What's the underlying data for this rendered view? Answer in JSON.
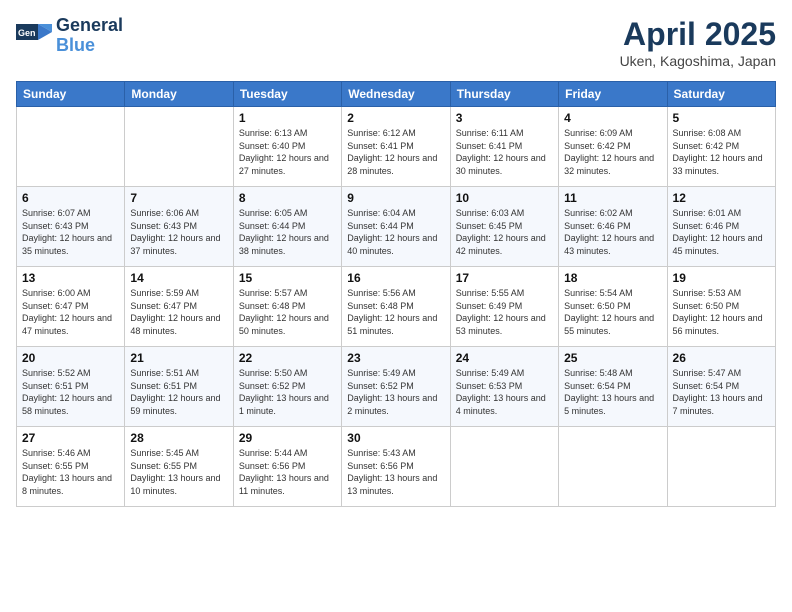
{
  "header": {
    "logo_line1": "General",
    "logo_line2": "Blue",
    "month": "April 2025",
    "location": "Uken, Kagoshima, Japan"
  },
  "weekdays": [
    "Sunday",
    "Monday",
    "Tuesday",
    "Wednesday",
    "Thursday",
    "Friday",
    "Saturday"
  ],
  "weeks": [
    [
      {
        "day": null
      },
      {
        "day": null
      },
      {
        "day": "1",
        "sunrise": "Sunrise: 6:13 AM",
        "sunset": "Sunset: 6:40 PM",
        "daylight": "Daylight: 12 hours and 27 minutes."
      },
      {
        "day": "2",
        "sunrise": "Sunrise: 6:12 AM",
        "sunset": "Sunset: 6:41 PM",
        "daylight": "Daylight: 12 hours and 28 minutes."
      },
      {
        "day": "3",
        "sunrise": "Sunrise: 6:11 AM",
        "sunset": "Sunset: 6:41 PM",
        "daylight": "Daylight: 12 hours and 30 minutes."
      },
      {
        "day": "4",
        "sunrise": "Sunrise: 6:09 AM",
        "sunset": "Sunset: 6:42 PM",
        "daylight": "Daylight: 12 hours and 32 minutes."
      },
      {
        "day": "5",
        "sunrise": "Sunrise: 6:08 AM",
        "sunset": "Sunset: 6:42 PM",
        "daylight": "Daylight: 12 hours and 33 minutes."
      }
    ],
    [
      {
        "day": "6",
        "sunrise": "Sunrise: 6:07 AM",
        "sunset": "Sunset: 6:43 PM",
        "daylight": "Daylight: 12 hours and 35 minutes."
      },
      {
        "day": "7",
        "sunrise": "Sunrise: 6:06 AM",
        "sunset": "Sunset: 6:43 PM",
        "daylight": "Daylight: 12 hours and 37 minutes."
      },
      {
        "day": "8",
        "sunrise": "Sunrise: 6:05 AM",
        "sunset": "Sunset: 6:44 PM",
        "daylight": "Daylight: 12 hours and 38 minutes."
      },
      {
        "day": "9",
        "sunrise": "Sunrise: 6:04 AM",
        "sunset": "Sunset: 6:44 PM",
        "daylight": "Daylight: 12 hours and 40 minutes."
      },
      {
        "day": "10",
        "sunrise": "Sunrise: 6:03 AM",
        "sunset": "Sunset: 6:45 PM",
        "daylight": "Daylight: 12 hours and 42 minutes."
      },
      {
        "day": "11",
        "sunrise": "Sunrise: 6:02 AM",
        "sunset": "Sunset: 6:46 PM",
        "daylight": "Daylight: 12 hours and 43 minutes."
      },
      {
        "day": "12",
        "sunrise": "Sunrise: 6:01 AM",
        "sunset": "Sunset: 6:46 PM",
        "daylight": "Daylight: 12 hours and 45 minutes."
      }
    ],
    [
      {
        "day": "13",
        "sunrise": "Sunrise: 6:00 AM",
        "sunset": "Sunset: 6:47 PM",
        "daylight": "Daylight: 12 hours and 47 minutes."
      },
      {
        "day": "14",
        "sunrise": "Sunrise: 5:59 AM",
        "sunset": "Sunset: 6:47 PM",
        "daylight": "Daylight: 12 hours and 48 minutes."
      },
      {
        "day": "15",
        "sunrise": "Sunrise: 5:57 AM",
        "sunset": "Sunset: 6:48 PM",
        "daylight": "Daylight: 12 hours and 50 minutes."
      },
      {
        "day": "16",
        "sunrise": "Sunrise: 5:56 AM",
        "sunset": "Sunset: 6:48 PM",
        "daylight": "Daylight: 12 hours and 51 minutes."
      },
      {
        "day": "17",
        "sunrise": "Sunrise: 5:55 AM",
        "sunset": "Sunset: 6:49 PM",
        "daylight": "Daylight: 12 hours and 53 minutes."
      },
      {
        "day": "18",
        "sunrise": "Sunrise: 5:54 AM",
        "sunset": "Sunset: 6:50 PM",
        "daylight": "Daylight: 12 hours and 55 minutes."
      },
      {
        "day": "19",
        "sunrise": "Sunrise: 5:53 AM",
        "sunset": "Sunset: 6:50 PM",
        "daylight": "Daylight: 12 hours and 56 minutes."
      }
    ],
    [
      {
        "day": "20",
        "sunrise": "Sunrise: 5:52 AM",
        "sunset": "Sunset: 6:51 PM",
        "daylight": "Daylight: 12 hours and 58 minutes."
      },
      {
        "day": "21",
        "sunrise": "Sunrise: 5:51 AM",
        "sunset": "Sunset: 6:51 PM",
        "daylight": "Daylight: 12 hours and 59 minutes."
      },
      {
        "day": "22",
        "sunrise": "Sunrise: 5:50 AM",
        "sunset": "Sunset: 6:52 PM",
        "daylight": "Daylight: 13 hours and 1 minute."
      },
      {
        "day": "23",
        "sunrise": "Sunrise: 5:49 AM",
        "sunset": "Sunset: 6:52 PM",
        "daylight": "Daylight: 13 hours and 2 minutes."
      },
      {
        "day": "24",
        "sunrise": "Sunrise: 5:49 AM",
        "sunset": "Sunset: 6:53 PM",
        "daylight": "Daylight: 13 hours and 4 minutes."
      },
      {
        "day": "25",
        "sunrise": "Sunrise: 5:48 AM",
        "sunset": "Sunset: 6:54 PM",
        "daylight": "Daylight: 13 hours and 5 minutes."
      },
      {
        "day": "26",
        "sunrise": "Sunrise: 5:47 AM",
        "sunset": "Sunset: 6:54 PM",
        "daylight": "Daylight: 13 hours and 7 minutes."
      }
    ],
    [
      {
        "day": "27",
        "sunrise": "Sunrise: 5:46 AM",
        "sunset": "Sunset: 6:55 PM",
        "daylight": "Daylight: 13 hours and 8 minutes."
      },
      {
        "day": "28",
        "sunrise": "Sunrise: 5:45 AM",
        "sunset": "Sunset: 6:55 PM",
        "daylight": "Daylight: 13 hours and 10 minutes."
      },
      {
        "day": "29",
        "sunrise": "Sunrise: 5:44 AM",
        "sunset": "Sunset: 6:56 PM",
        "daylight": "Daylight: 13 hours and 11 minutes."
      },
      {
        "day": "30",
        "sunrise": "Sunrise: 5:43 AM",
        "sunset": "Sunset: 6:56 PM",
        "daylight": "Daylight: 13 hours and 13 minutes."
      },
      {
        "day": null
      },
      {
        "day": null
      },
      {
        "day": null
      }
    ]
  ]
}
